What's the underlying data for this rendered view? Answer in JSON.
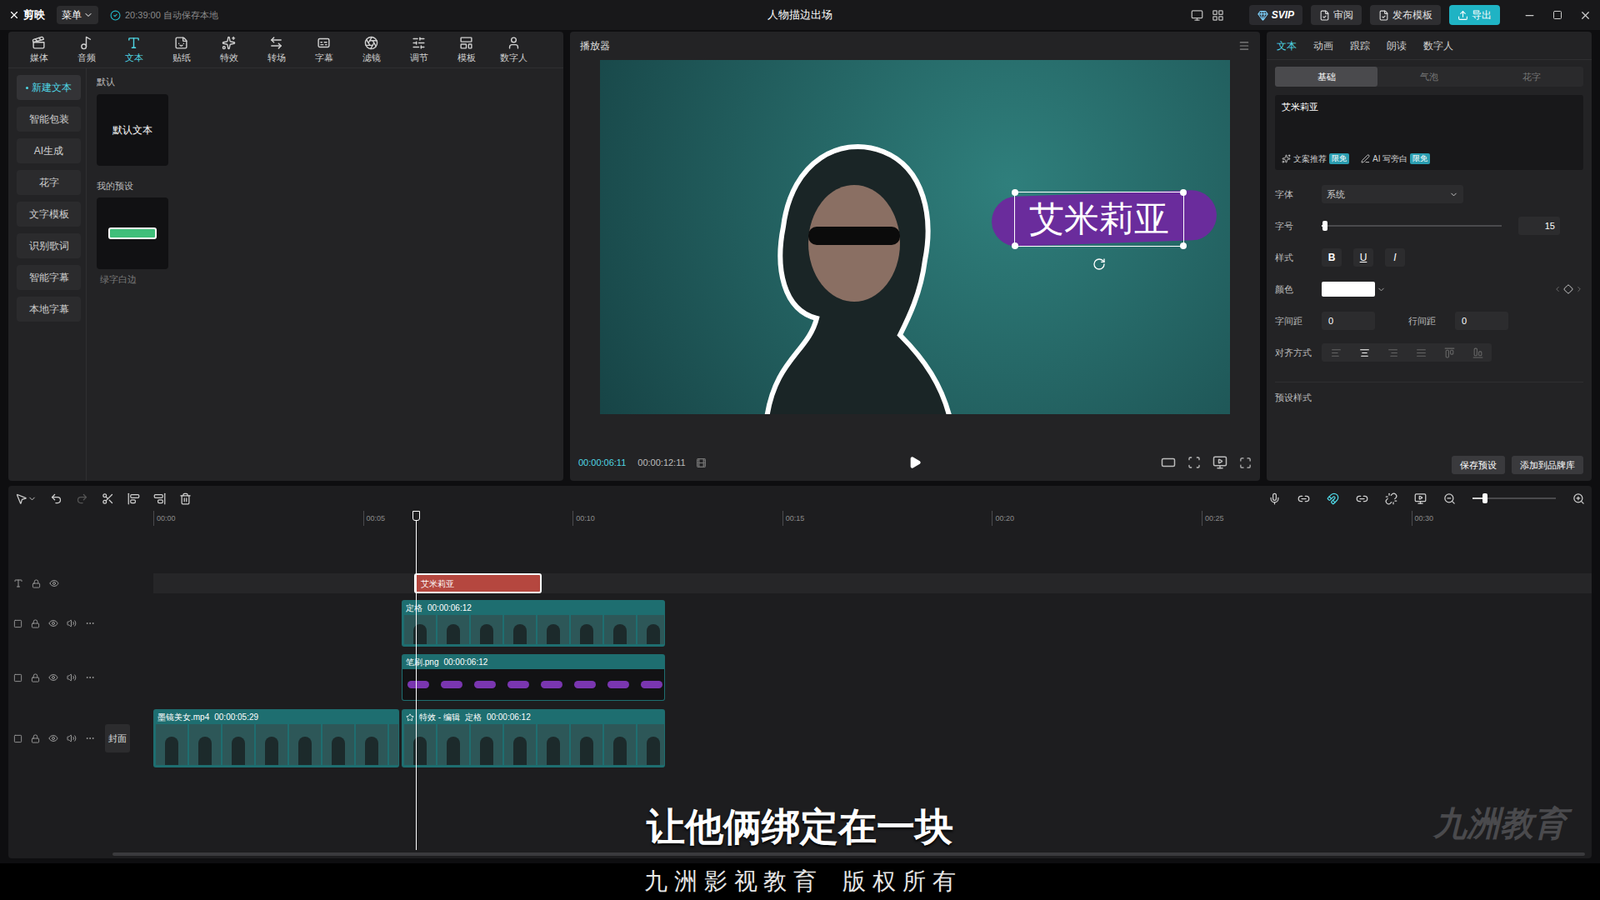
{
  "app": {
    "logo": "剪映",
    "menu": "菜单",
    "autosave": "20:39:00 自动保存本地"
  },
  "window": {
    "title": "人物描边出场"
  },
  "top_actions": [
    {
      "label": "SVIP",
      "kind": "badge"
    },
    {
      "label": "审阅",
      "kind": "plain"
    },
    {
      "label": "发布模板",
      "kind": "plain"
    },
    {
      "label": "导出",
      "kind": "primary"
    }
  ],
  "toolbar_tabs": [
    {
      "label": "媒体",
      "selected": false
    },
    {
      "label": "音频",
      "selected": false
    },
    {
      "label": "文本",
      "selected": true
    },
    {
      "label": "贴纸",
      "selected": false
    },
    {
      "label": "特效",
      "selected": false
    },
    {
      "label": "转场",
      "selected": false
    },
    {
      "label": "字幕",
      "selected": false
    },
    {
      "label": "滤镜",
      "selected": false
    },
    {
      "label": "调节",
      "selected": false
    },
    {
      "label": "模板",
      "selected": false
    },
    {
      "label": "数字人",
      "selected": false
    }
  ],
  "sidebar": {
    "items": [
      {
        "label": "新建文本",
        "selected": true
      },
      {
        "label": "智能包装",
        "selected": false
      },
      {
        "label": "AI生成",
        "selected": false
      },
      {
        "label": "花字",
        "selected": false
      },
      {
        "label": "文字模板",
        "selected": false
      },
      {
        "label": "识别歌词",
        "selected": false
      },
      {
        "label": "智能字幕",
        "selected": false
      },
      {
        "label": "本地字幕",
        "selected": false
      }
    ]
  },
  "library": {
    "default_title": "默认",
    "default_card": "默认文本",
    "preset_title": "我的预设",
    "preset_caption": "绿字白边"
  },
  "player": {
    "title": "播放器",
    "current_time": "00:00:06:11",
    "total_time": "00:00:12:11",
    "preview_text": "艾米莉亚",
    "preview_text_selected": true
  },
  "inspector": {
    "tabs": [
      {
        "label": "文本",
        "selected": true
      },
      {
        "label": "动画",
        "selected": false
      },
      {
        "label": "跟踪",
        "selected": false
      },
      {
        "label": "朗读",
        "selected": false
      },
      {
        "label": "数字人",
        "selected": false
      }
    ],
    "subtabs": [
      {
        "label": "基础",
        "selected": true
      },
      {
        "label": "气泡",
        "selected": false
      },
      {
        "label": "花字",
        "selected": false
      }
    ],
    "text_value": "艾米莉亚",
    "ai_buttons": [
      {
        "label": "文案推荐",
        "badge": "限免"
      },
      {
        "label": "AI 写旁白",
        "badge": "限免"
      }
    ],
    "font": {
      "label": "字体",
      "value": "系统"
    },
    "size": {
      "label": "字号",
      "value": "15",
      "level": 0.02
    },
    "style": {
      "label": "样式",
      "buttons": [
        {
          "label": "B",
          "on": false
        },
        {
          "label": "U",
          "on": false
        },
        {
          "label": "I",
          "on": false
        }
      ]
    },
    "color": {
      "label": "颜色",
      "value": "#ffffff"
    },
    "letter_spacing": {
      "label": "字间距",
      "value": "0"
    },
    "line_spacing": {
      "label": "行间距",
      "value": "0"
    },
    "align": {
      "label": "对齐方式",
      "options": [
        {
          "selected": false
        },
        {
          "selected": true
        },
        {
          "selected": false
        },
        {
          "selected": false
        },
        {
          "selected": false
        },
        {
          "selected": false
        }
      ]
    },
    "preset_label": "预设样式",
    "buttons": [
      "保存预设",
      "添加到品牌库"
    ]
  },
  "timeline": {
    "zoom_level": 0.15,
    "ruler": [
      "00:00",
      "00:05",
      "00:10",
      "00:15",
      "00:20",
      "00:25",
      "00:30"
    ],
    "tracks": [
      {
        "kind": "text",
        "clips": [
          {
            "label": "艾米莉亚",
            "selected": true
          }
        ]
      },
      {
        "kind": "video",
        "clips": [
          {
            "label": "定格",
            "duration": "00:00:06:12",
            "selected": false
          }
        ]
      },
      {
        "kind": "brush",
        "clips": [
          {
            "label": "笔刷.png",
            "duration": "00:00:06:12",
            "selected": false
          }
        ]
      },
      {
        "kind": "main",
        "cover": "封面",
        "clips": [
          {
            "label": "墨镜美女.mp4",
            "duration": "00:00:05:29",
            "selected": false
          },
          {
            "label": "特效 - 编辑",
            "tag": "定格",
            "duration": "00:00:06:12",
            "selected": false
          }
        ]
      }
    ]
  },
  "overlays": {
    "subtitle": "让他俩绑定在一块",
    "watermark": "九洲教育",
    "footer": "九 洲 影 视 教 育    版 权 所 有"
  }
}
